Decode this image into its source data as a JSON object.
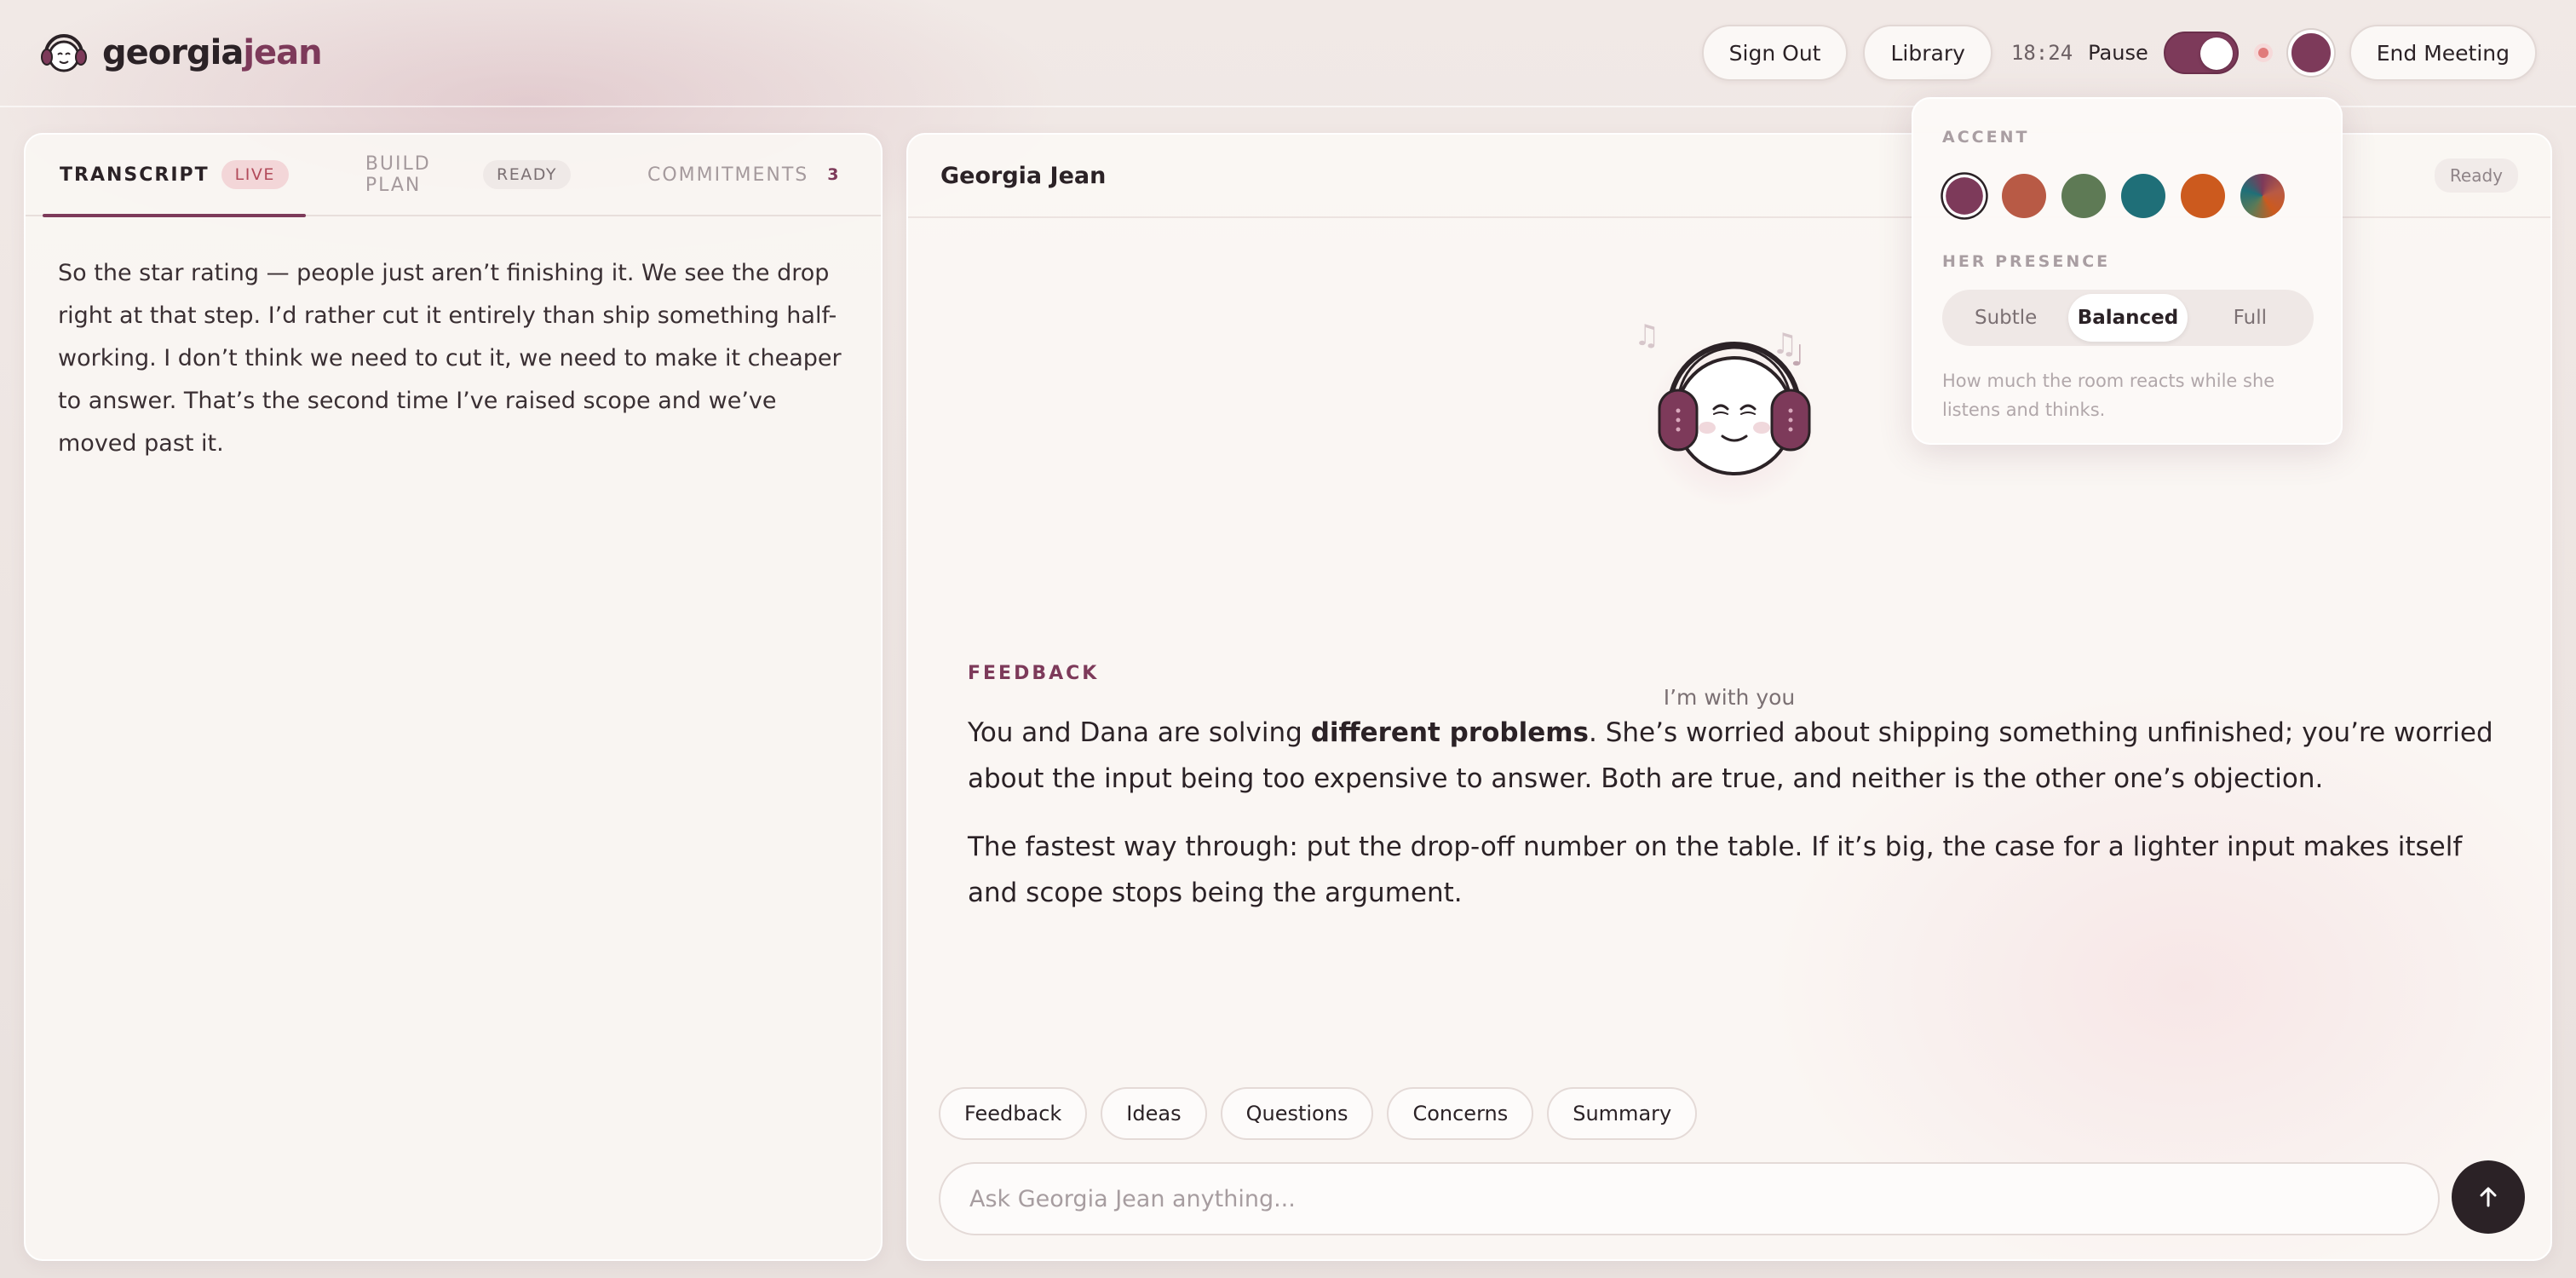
{
  "app": {
    "brand_prefix": "georgia",
    "brand_suffix": "jean"
  },
  "header": {
    "sign_out": "Sign Out",
    "library": "Library",
    "timer": "18:24",
    "pause_label": "Pause",
    "end_meeting": "End Meeting"
  },
  "left_panel": {
    "tabs": [
      {
        "label": "TRANSCRIPT",
        "badge": "LIVE"
      },
      {
        "label": "BUILD PLAN",
        "badge": "READY"
      },
      {
        "label": "COMMITMENTS",
        "badge": "3"
      }
    ],
    "transcript_text": "So the star rating — people just aren’t finishing it. We see the drop right at that step. I’d rather cut it entirely than ship something half-working. I don’t think we need to cut it, we need to make it cheaper to answer. That’s the second time I’ve raised scope and we’ve moved past it."
  },
  "main_panel": {
    "agent_name": "Georgia Jean",
    "status": "Ready",
    "avatar_caption": "I’m with you",
    "feedback_label": "FEEDBACK",
    "para1_before": "You and Dana are solving ",
    "para1_bold": "different problems",
    "para1_after": ". She’s worried about shipping something unfinished; you’re worried about the input being too expensive to answer. Both are true, and neither is the other one’s objection.",
    "para2": "The fastest way through: put the drop-off number on the table. If it’s big, the case for a lighter input makes itself and scope stops being the argument.",
    "chips": [
      "Feedback",
      "Ideas",
      "Questions",
      "Concerns",
      "Summary"
    ],
    "ask_placeholder": "Ask Georgia Jean anything..."
  },
  "popover": {
    "accent_label": "ACCENT",
    "accent_colors": [
      "#7d3a5a",
      "#b85a45",
      "#5e7a55",
      "#1f6f78",
      "#cc5a1e",
      "conic"
    ],
    "selected_accent": 0,
    "presence_label": "HER PRESENCE",
    "presence_options": [
      "Subtle",
      "Balanced",
      "Full"
    ],
    "selected_presence": 1,
    "hint": "How much the room reacts while she listens and thinks."
  },
  "colors": {
    "accent": "#7d3a5a",
    "live_badge_bg": "#f3d6d8",
    "live_badge_text": "#b24a5a"
  },
  "icons": {
    "send": "arrow-up-icon",
    "notes": "music-notes-icon",
    "recording": "recording-dot-icon"
  }
}
